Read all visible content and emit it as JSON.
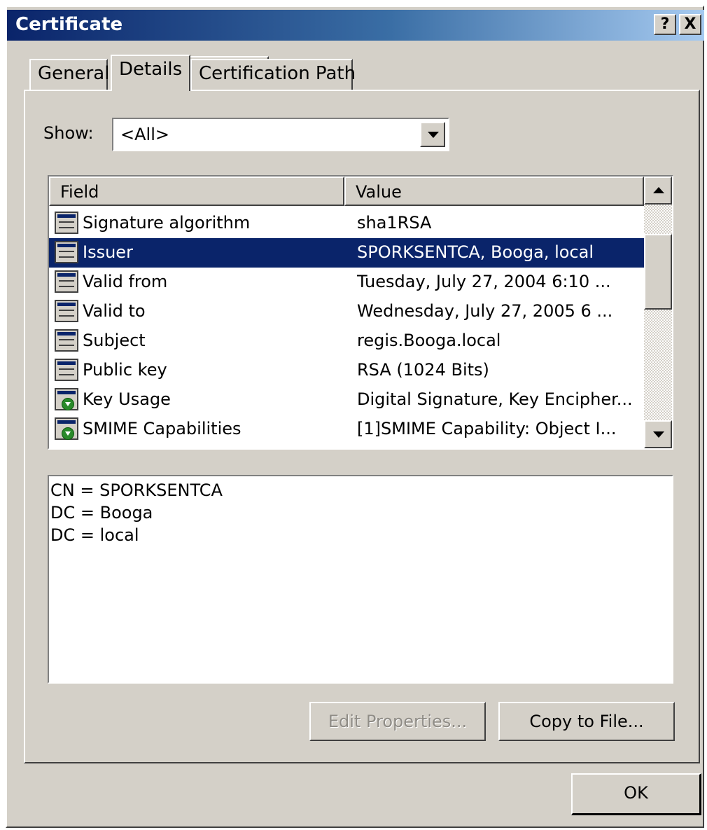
{
  "window": {
    "title": "Certificate",
    "help_label": "?",
    "close_label": "X"
  },
  "tabs": [
    {
      "label": "General",
      "active": false
    },
    {
      "label": "Details",
      "active": true
    },
    {
      "label": "Certification Path",
      "active": false
    }
  ],
  "show": {
    "label": "Show:",
    "value": "<All>"
  },
  "list": {
    "columns": [
      "Field",
      "Value"
    ],
    "rows": [
      {
        "field": "Signature algorithm",
        "value": "sha1RSA",
        "icon": "certificate-field-icon"
      },
      {
        "field": "Issuer",
        "value": "SPORKSENTCA, Booga, local",
        "icon": "certificate-field-icon",
        "selected": true
      },
      {
        "field": "Valid from",
        "value": "Tuesday, July 27, 2004 6:10 ...",
        "icon": "certificate-field-icon"
      },
      {
        "field": "Valid to",
        "value": "Wednesday, July 27, 2005 6 ...",
        "icon": "certificate-field-icon"
      },
      {
        "field": "Subject",
        "value": "regis.Booga.local",
        "icon": "certificate-field-icon"
      },
      {
        "field": "Public key",
        "value": "RSA (1024 Bits)",
        "icon": "certificate-field-icon"
      },
      {
        "field": "Key Usage",
        "value": "Digital Signature, Key Encipher...",
        "icon": "certificate-extension-icon"
      },
      {
        "field": "SMIME Capabilities",
        "value": "[1]SMIME Capability: Object I...",
        "icon": "certificate-extension-icon"
      }
    ]
  },
  "details": {
    "lines": [
      "CN = SPORKSENTCA",
      "DC = Booga",
      "DC = local"
    ]
  },
  "buttons": {
    "edit_properties": "Edit Properties...",
    "copy_to_file": "Copy to File...",
    "ok": "OK"
  },
  "colors": {
    "selection": "#0a246a",
    "face": "#d4d0c8"
  }
}
